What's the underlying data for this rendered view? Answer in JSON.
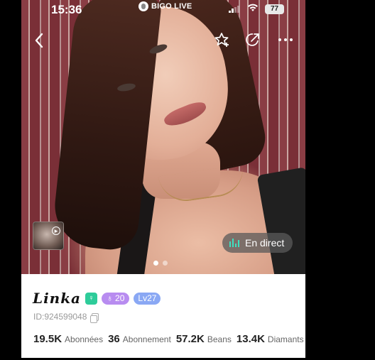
{
  "status_bar": {
    "time": "15:36",
    "app_name": "BIGO LIVE",
    "battery": "77"
  },
  "nav": {
    "back_icon": "chevron-left-icon",
    "follow_icon": "star-plus-icon",
    "share_icon": "share-icon",
    "more_icon": "more-horizontal-icon"
  },
  "media": {
    "live_label": "En direct",
    "page_count": 2,
    "active_page": 1
  },
  "profile": {
    "name": "Linka",
    "fan_badge": "20",
    "level_badge": "Lv27",
    "id_text": "ID:924599048"
  },
  "stats": [
    {
      "value": "19.5K",
      "label": "Abonnées"
    },
    {
      "value": "36",
      "label": "Abonnement"
    },
    {
      "value": "57.2K",
      "label": "Beans"
    },
    {
      "value": "13.4K",
      "label": "Diamants"
    }
  ],
  "colors": {
    "gender_badge": "#2ecc9a",
    "fan_badge": "#b88cf0",
    "level_badge": "#8aa8f4",
    "live_accent": "#3fe0c0"
  }
}
